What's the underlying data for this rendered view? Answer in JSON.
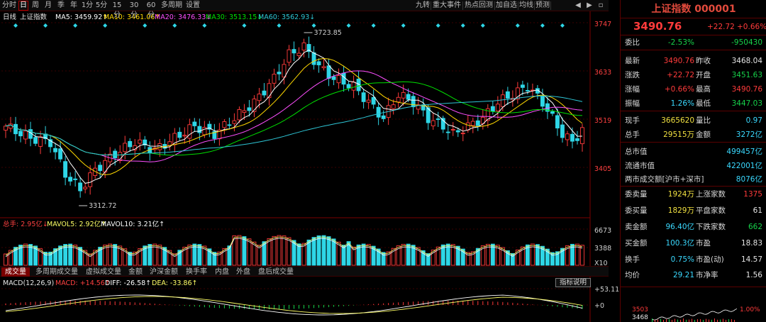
{
  "toolbar": {
    "left_items": [
      "分时",
      "日",
      "周",
      "月",
      "季",
      "年",
      "1分",
      "5分",
      "15分",
      "30分",
      "60分",
      "多周期",
      "设置"
    ],
    "right_items": [
      "九转",
      "重大事件",
      "热点回测",
      "加自选",
      "均线",
      "预测"
    ],
    "icons": [
      "chevron-left-icon",
      "chevron-right-icon",
      "window-icon"
    ]
  },
  "legend": {
    "period": "日线",
    "name": "上证指数",
    "ma": [
      {
        "label": "MA5: 3459.92↑",
        "color": "#ffffff"
      },
      {
        "label": "MA10: 3461.06↑",
        "color": "#ffd800"
      },
      {
        "label": "MA20: 3476.33↓",
        "color": "#ff4fff"
      },
      {
        "label": "MA30: 3513.15↓",
        "color": "#00e000"
      },
      {
        "label": "MA60: 3562.93↓",
        "color": "#2ec6d6"
      }
    ]
  },
  "price_axis_labels": [
    "3747",
    "3633",
    "3519",
    "3405"
  ],
  "annotations": {
    "high": "3723.85",
    "low": "3312.72"
  },
  "volume_legend": [
    {
      "label": "总手: 2.95亿↓",
      "color": "#ff4040"
    },
    {
      "label": "MAVOL5: 2.92亿↑",
      "color": "#ffff66"
    },
    {
      "label": "MAVOL10: 3.21亿↑",
      "color": "#ffffff"
    }
  ],
  "volume_axis_labels": [
    "6673",
    "3388",
    "X10"
  ],
  "indicator_tabs": [
    "成交量",
    "多周期成交量",
    "虚拟成交量",
    "金额",
    "沪深金额",
    "换手率",
    "内盘",
    "外盘",
    "盘后成交量"
  ],
  "macd_legend": [
    {
      "label": "MACD(12,26,9)",
      "color": "#e6e6e6"
    },
    {
      "label": "MACD: +14.56↑",
      "color": "#ff4040"
    },
    {
      "label": "DIFF: -26.58↑",
      "color": "#ffffff"
    },
    {
      "label": "DEA: -33.86↑",
      "color": "#ffff66"
    }
  ],
  "macd_axis_labels": [
    "+53.11",
    "+0"
  ],
  "explain_button": "指标说明",
  "side": {
    "title": "上证指数 000001",
    "price": "3490.76",
    "change": "+22.72",
    "change_pct": "+0.66%",
    "rows": [
      {
        "k1": "委比",
        "v1": "-2.53%",
        "c1": "green",
        "k2": "",
        "v2": "-950430",
        "c2": "green"
      },
      {
        "k1": "最新",
        "v1": "3490.76",
        "c1": "red",
        "k2": "昨收",
        "v2": "3468.04",
        "c2": "white"
      },
      {
        "k1": "涨跌",
        "v1": "+22.72",
        "c1": "red",
        "k2": "开盘",
        "v2": "3451.63",
        "c2": "green"
      },
      {
        "k1": "涨幅",
        "v1": "+0.66%",
        "c1": "red",
        "k2": "最高",
        "v2": "3490.76",
        "c2": "red"
      },
      {
        "k1": "振幅",
        "v1": "1.26%",
        "c1": "cyan",
        "k2": "最低",
        "v2": "3447.03",
        "c2": "green"
      },
      {
        "k1": "现手",
        "v1": "3665620",
        "c1": "yellow",
        "k2": "量比",
        "v2": "0.97",
        "c2": "cyan"
      },
      {
        "k1": "总手",
        "v1": "29515万",
        "c1": "yellow",
        "k2": "金额",
        "v2": "3272亿",
        "c2": "cyan"
      },
      {
        "k1": "总市值",
        "v1": "",
        "c1": "",
        "k2": "",
        "v2": "499457亿",
        "c2": "cyan"
      },
      {
        "k1": "流通市值",
        "v1": "",
        "c1": "",
        "k2": "",
        "v2": "422001亿",
        "c2": "cyan"
      },
      {
        "k1": "两市成交额[沪市+深市]",
        "v1": "",
        "c1": "",
        "k2": "",
        "v2": "8076亿",
        "c2": "cyan"
      },
      {
        "k1": "委卖量",
        "v1": "1924万",
        "c1": "yellow",
        "k2": "上涨家数",
        "v2": "1375",
        "c2": "red"
      },
      {
        "k1": "委买量",
        "v1": "1829万",
        "c1": "yellow",
        "k2": "平盘家数",
        "v2": "61",
        "c2": "white"
      },
      {
        "k1": "卖金额",
        "v1": "96.40亿",
        "c1": "cyan",
        "k2": "下跌家数",
        "v2": "662",
        "c2": "green"
      },
      {
        "k1": "买金额",
        "v1": "100.3亿",
        "c1": "cyan",
        "k2": "市盈",
        "v2": "18.83",
        "c2": "white"
      },
      {
        "k1": "换手",
        "v1": "0.75%",
        "c1": "cyan",
        "k2": "市盈(动)",
        "v2": "14.57",
        "c2": "white"
      },
      {
        "k1": "均价",
        "v1": "29.21",
        "c1": "cyan",
        "k2": "市净率",
        "v2": "1.56",
        "c2": "white"
      }
    ],
    "mini": {
      "left_top": "3503",
      "left_bottom": "3468",
      "right_top": "1.00%"
    }
  },
  "chart_data": {
    "type": "candlestick",
    "title": "上证指数 日线",
    "ylim": [
      3300,
      3760
    ],
    "high_annotation": 3723.85,
    "low_annotation": 3312.72,
    "last": {
      "open": 3451.63,
      "high": 3490.76,
      "low": 3447.03,
      "close": 3490.76
    },
    "ma_last": {
      "MA5": 3459.92,
      "MA10": 3461.06,
      "MA20": 3476.33,
      "MA30": 3513.15,
      "MA60": 3562.93
    },
    "volume_axis": [
      3388,
      6673
    ],
    "macd_last": {
      "MACD": 14.56,
      "DIFF": -26.58,
      "DEA": -33.86
    },
    "candle_count": 117
  }
}
